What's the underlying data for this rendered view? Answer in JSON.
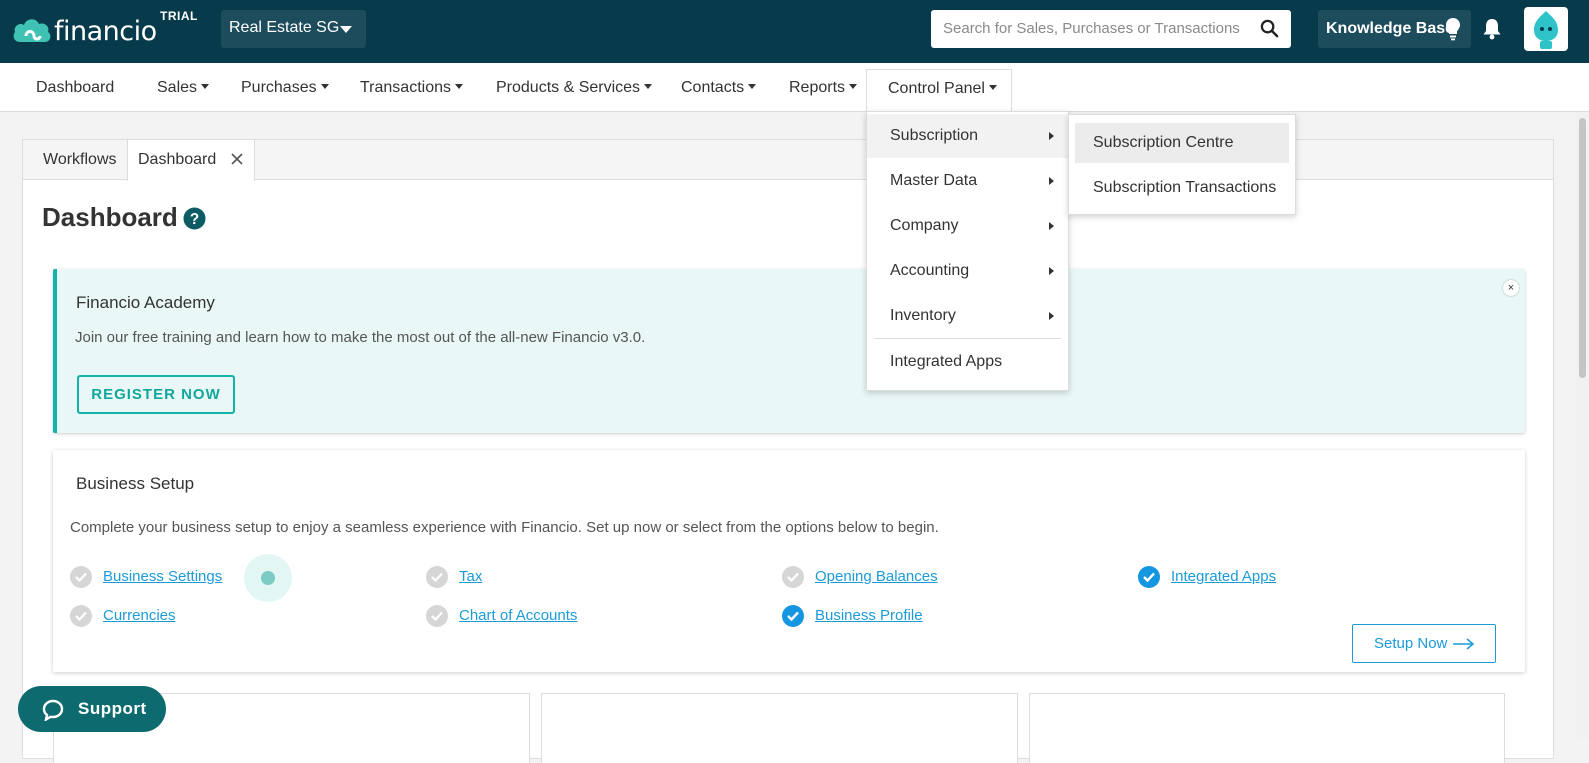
{
  "header": {
    "logo_text": "financio",
    "trial_badge": "TRIAL",
    "company": "Real Estate SG",
    "search_placeholder": "Search for Sales, Purchases or Transactions",
    "knowledge_base": "Knowledge Base"
  },
  "nav": {
    "items": [
      "Dashboard",
      "Sales",
      "Purchases",
      "Transactions",
      "Products & Services",
      "Contacts",
      "Reports",
      "Control Panel"
    ]
  },
  "tabs": [
    "Workflows",
    "Dashboard"
  ],
  "page_title": "Dashboard",
  "academy": {
    "title": "Financio Academy",
    "description": "Join our free training and learn how to make the most out of the all-new Financio v3.0.",
    "register": "REGISTER NOW",
    "close": "×"
  },
  "setup": {
    "title": "Business Setup",
    "description": "Complete your business setup to enjoy a seamless experience with Financio. Set up now or select from the options below to begin.",
    "links": [
      {
        "label": "Business Settings",
        "done": false
      },
      {
        "label": "Tax",
        "done": false
      },
      {
        "label": "Opening Balances",
        "done": false
      },
      {
        "label": "Integrated Apps",
        "done": true
      },
      {
        "label": "Currencies",
        "done": false
      },
      {
        "label": "Chart of Accounts",
        "done": false
      },
      {
        "label": "Business Profile",
        "done": true
      }
    ],
    "setup_now": "Setup Now"
  },
  "support": "Support",
  "control_panel_menu": {
    "items": [
      "Subscription",
      "Master Data",
      "Company",
      "Accounting",
      "Inventory",
      "Integrated Apps"
    ],
    "submenu": [
      "Subscription Centre",
      "Subscription Transactions"
    ]
  },
  "colors": {
    "header_bg": "#073b4c",
    "accent_teal": "#12b3a8",
    "link_blue": "#1c9bd8",
    "support_bg": "#0d6b70"
  }
}
